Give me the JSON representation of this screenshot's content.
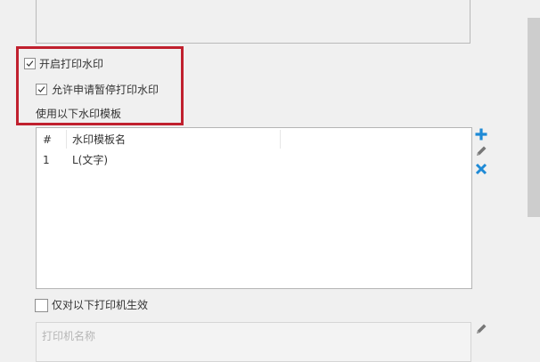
{
  "watermark": {
    "enable_label": "开启打印水印",
    "enable_checked": true,
    "allow_pause_label": "允许申请暂停打印水印",
    "allow_pause_checked": true,
    "use_template_label": "使用以下水印模板"
  },
  "template_table": {
    "columns": [
      "#",
      "水印模板名"
    ],
    "rows": [
      {
        "index": "1",
        "name": "L(文字)"
      }
    ]
  },
  "toolbar": {
    "add_icon": "plus-icon",
    "edit_icon": "pencil-icon",
    "delete_icon": "x-icon",
    "accent_color": "#1e8ad6"
  },
  "printer_filter": {
    "label": "仅对以下打印机生效",
    "checked": false,
    "placeholder": "打印机名称",
    "edit_icon": "pencil-icon"
  },
  "colors": {
    "highlight": "#c0202e"
  }
}
